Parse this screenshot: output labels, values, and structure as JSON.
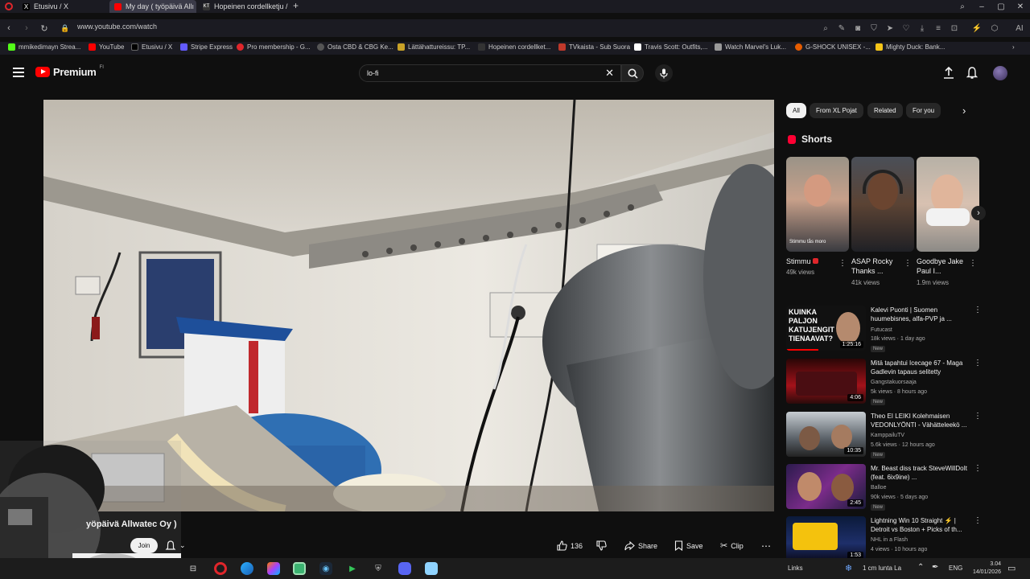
{
  "browser": {
    "tabs": [
      {
        "label": "Etusivu / X",
        "active": false
      },
      {
        "label": "My day ( työpäivä Allı",
        "active": true
      },
      {
        "label": "Hopeinen cordellketju / S",
        "active": false
      }
    ],
    "url": "www.youtube.com/watch",
    "bookmarks": [
      "mmikedimayn Strea...",
      "YouTube",
      "Etusivu / X",
      "Stripe Express",
      "Pro membership - G...",
      "Osta CBD & CBG Ke...",
      "Lättähattureissu: TP...",
      "Hopeinen cordellket...",
      "TVkaista - Sub Suora",
      "Travis Scott: Outfits,...",
      "Watch Marvel's Luk...",
      "G-SHOCK UNISEX -...",
      "Mighty Duck: Bank..."
    ]
  },
  "youtube": {
    "logo_text": "Premium",
    "logo_country": "FI",
    "search_value": "lo-fi",
    "channel_name": "yöpäivä Allwatec Oy )",
    "join_label": "Join",
    "like_count": "136",
    "share_label": "Share",
    "save_label": "Save",
    "clip_label": "Clip"
  },
  "sidebar": {
    "chips": [
      "All",
      "From XL Pojat",
      "Related",
      "For you"
    ],
    "shorts_title": "Shorts",
    "shorts": [
      {
        "title": "Stimmu",
        "views": "49k views",
        "caption": "Stimmu tås moro"
      },
      {
        "title": "ASAP Rocky Thanks ...",
        "views": "41k views"
      },
      {
        "title": "Goodbye Jake Paul I...",
        "views": "1.9m views"
      }
    ],
    "videos": [
      {
        "title": "Kalevi Puonti | Suomen huumebisnes, alfa-PVP ja ...",
        "channel": "Futucast",
        "meta": "18k views · 1 day ago",
        "badge": "New",
        "duration": "1:25:16",
        "thumb_text": "KUINKA PALJON KATUJENGIT TIENAAVAT?"
      },
      {
        "title": "Mitä tapahtui Icecage 67 - Maga Gadlevin tapaus selitetty",
        "channel": "Gangstakuorsaaja",
        "meta": "5k views · 8 hours ago",
        "badge": "New",
        "duration": "4:06"
      },
      {
        "title": "Theo EI LEIKI Kolehmaisen VEDONLYÖNTI - Vähätteleekö ...",
        "channel": "KamppailuTV",
        "meta": "5.6k views · 12 hours ago",
        "badge": "New",
        "duration": "10:35"
      },
      {
        "title": "Mr. Beast diss track SteveWillDoIt (feat. 6ix9ine) ...",
        "channel": "Balloe",
        "meta": "90k views · 5 days ago",
        "badge": "New",
        "duration": "2:45"
      },
      {
        "title": "Lightning Win 10 Straight ⚡ | Detroit vs Boston + Picks of th...",
        "channel": "NHL in a Flash",
        "meta": "4 views · 10 hours ago",
        "badge": "",
        "duration": "1:53"
      }
    ]
  },
  "taskbar": {
    "links": "Links",
    "weather": "1 cm lunta La",
    "lang": "ENG",
    "time": "3.04",
    "date": "14/01/2026"
  }
}
